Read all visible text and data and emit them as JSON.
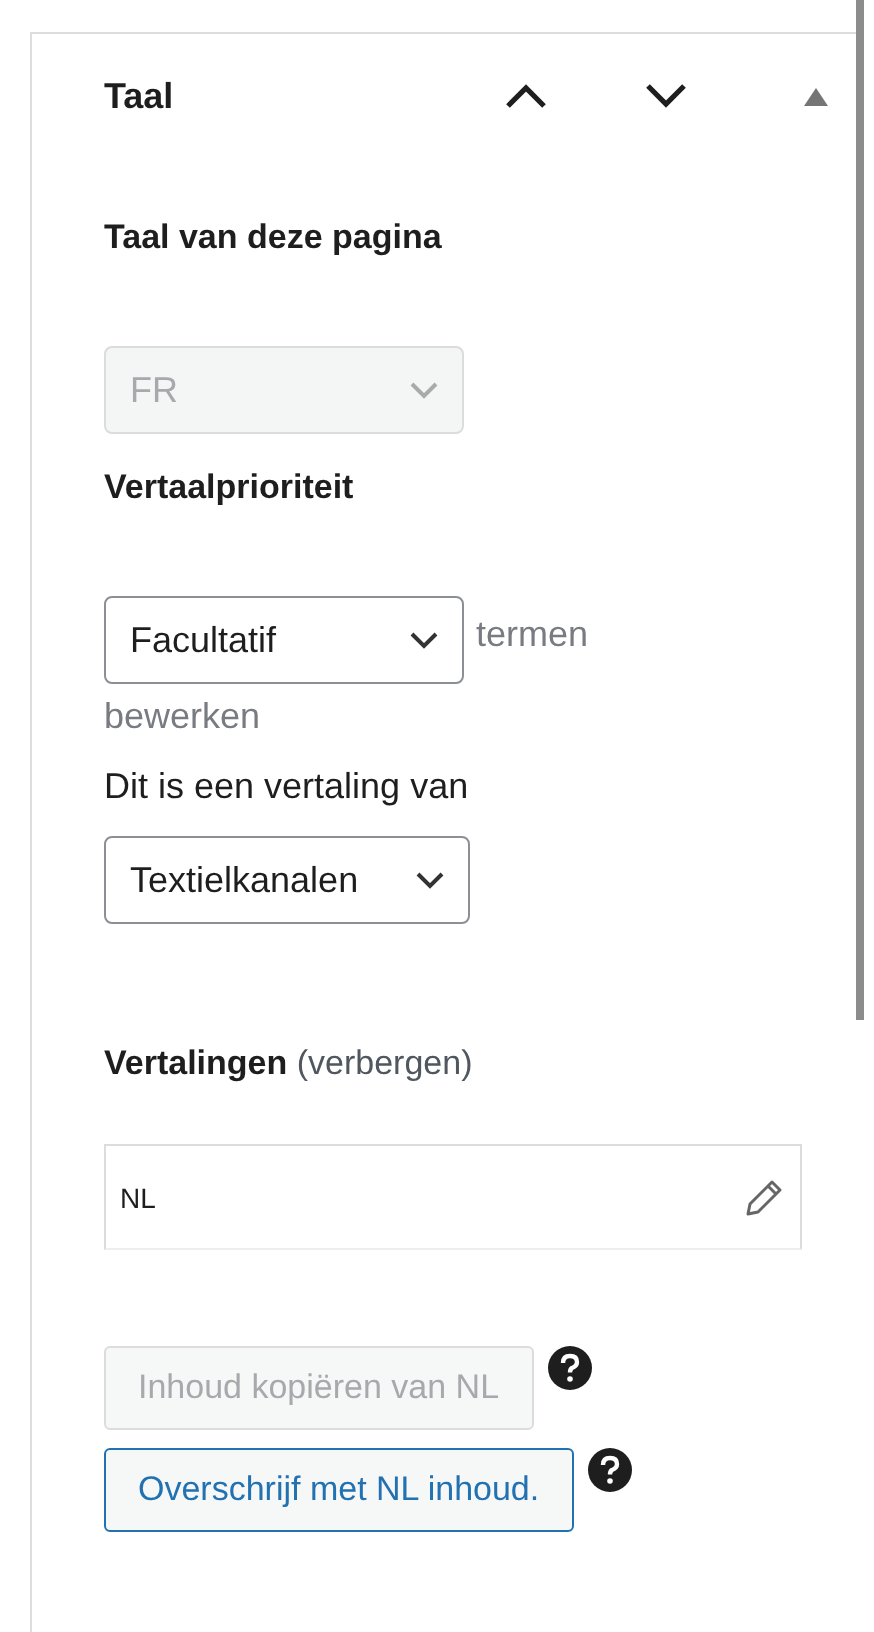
{
  "panel": {
    "title": "Taal",
    "expanded": true
  },
  "page_language": {
    "label": "Taal van deze pagina",
    "value": "FR",
    "disabled": true
  },
  "priority": {
    "label": "Vertaalprioriteit",
    "value": "Facultatif",
    "disabled": false,
    "link": [
      "termen",
      "bewerken"
    ]
  },
  "translation_of": {
    "label": "Dit is een vertaling van",
    "value": "Textielkanalen",
    "disabled": false
  },
  "translations": {
    "label": "Vertalingen",
    "toggle": "(verbergen)",
    "items": [
      {
        "language": "NL"
      }
    ]
  },
  "buttons": [
    {
      "label": "Inhoud kopiëren van NL",
      "disabled": true
    },
    {
      "label": "Overschrijf met NL inhoud.",
      "disabled": false
    }
  ]
}
